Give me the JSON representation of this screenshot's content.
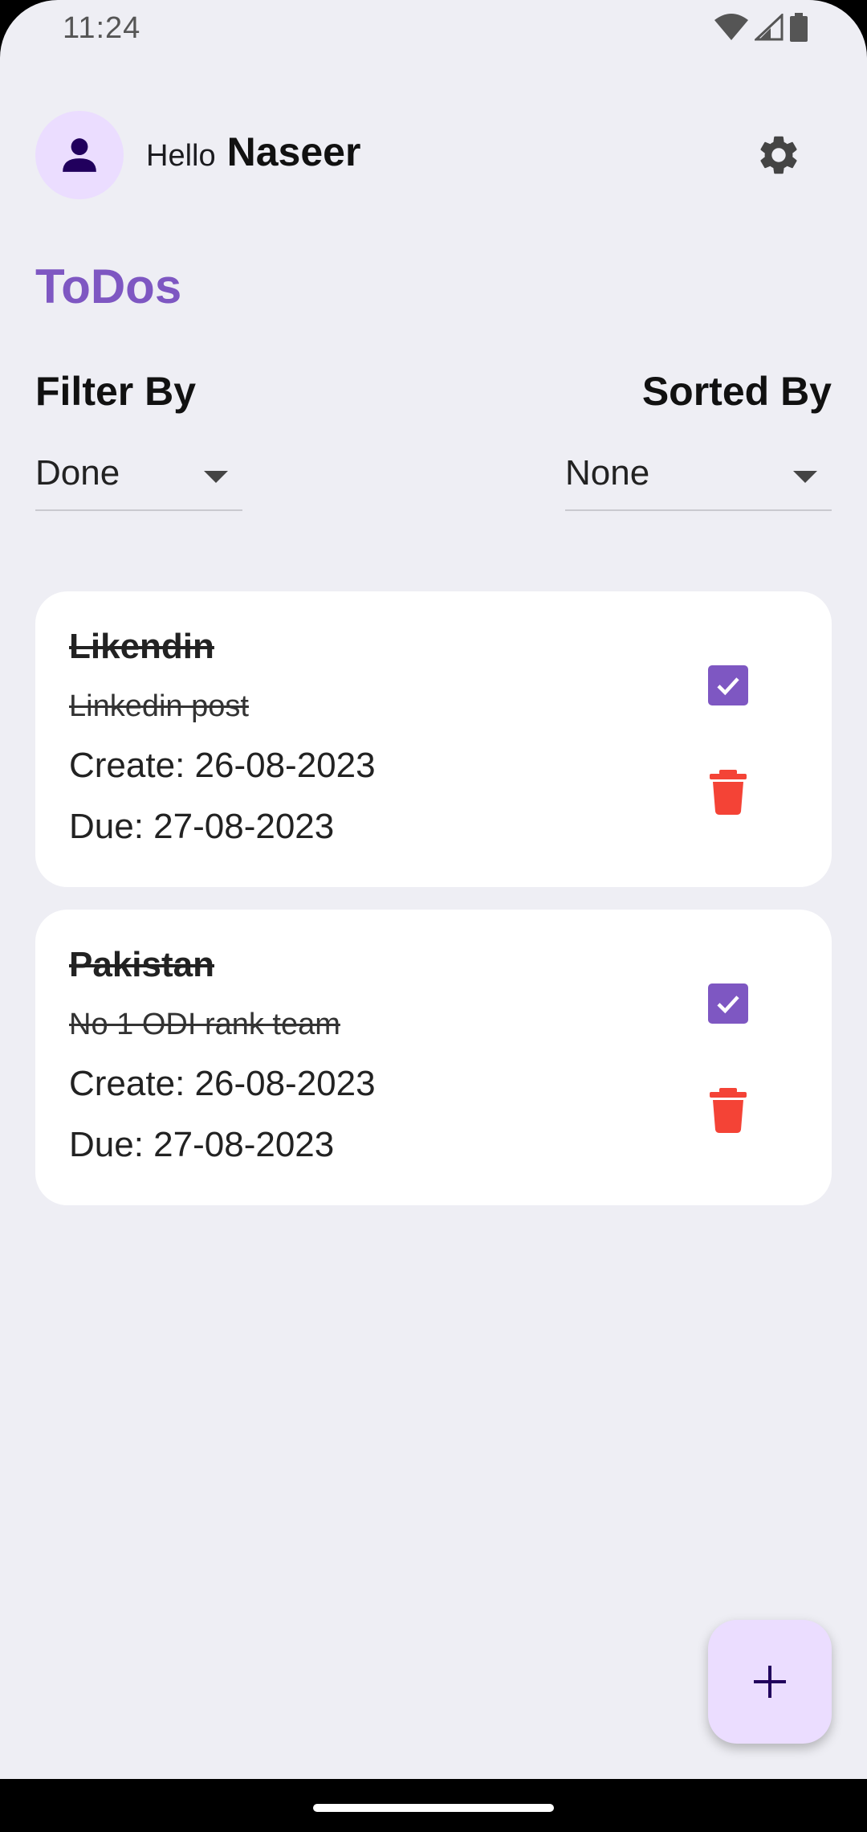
{
  "status_bar": {
    "time": "11:24",
    "icons": [
      "wifi-icon",
      "signal-icon",
      "battery-icon"
    ]
  },
  "header": {
    "avatar_icon": "person-icon",
    "greeting": "Hello",
    "user_name": "Naseer",
    "settings_icon": "gear-icon"
  },
  "page_title": "ToDos",
  "filter": {
    "label": "Filter By",
    "value": "Done"
  },
  "sort": {
    "label": "Sorted By",
    "value": "None"
  },
  "todos": [
    {
      "title": "Likendin",
      "description": "Linkedin post",
      "created": "Create: 26-08-2023",
      "due": "Due: 27-08-2023",
      "done": true
    },
    {
      "title": "Pakistan",
      "description": "No 1 ODI rank team",
      "created": "Create: 26-08-2023",
      "due": "Due: 27-08-2023",
      "done": true
    }
  ],
  "fab": {
    "icon": "plus-icon"
  },
  "colors": {
    "accent": "#7E57C2",
    "avatar_bg": "#EBDDFF",
    "delete": "#F44336",
    "background": "#EEEEF4"
  }
}
